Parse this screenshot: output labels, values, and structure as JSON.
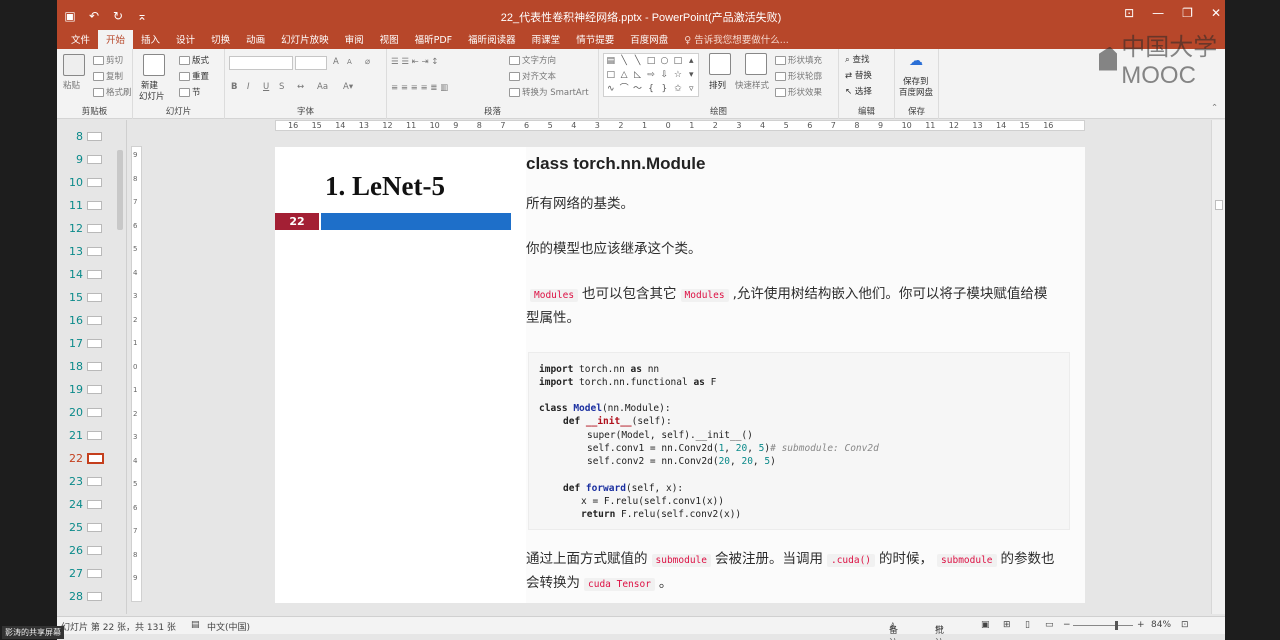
{
  "window": {
    "title": "22_代表性卷积神经网络.pptx - PowerPoint(产品激活失败)",
    "qat_icons": [
      "save-icon",
      "undo-icon",
      "redo-icon",
      "customize-icon"
    ],
    "controls": [
      "ribbon-display-icon",
      "minimize-icon",
      "restore-icon",
      "close-icon"
    ]
  },
  "tabs": [
    "文件",
    "开始",
    "插入",
    "设计",
    "切换",
    "动画",
    "幻灯片放映",
    "审阅",
    "视图",
    "福昕PDF",
    "福昕阅读器",
    "雨课堂",
    "情节提要",
    "百度网盘"
  ],
  "active_tab": "开始",
  "tell_me": "告诉我您想要做什么...",
  "ribbon": {
    "clipboard": {
      "label": "剪贴板",
      "paste": "粘贴",
      "cut": "剪切",
      "copy": "复制",
      "format_painter": "格式刷"
    },
    "slides": {
      "label": "幻灯片",
      "new_slide_1": "新建",
      "new_slide_2": "幻灯片",
      "layout": "版式",
      "reset": "重置",
      "section": "节"
    },
    "font": {
      "label": "字体",
      "bold": "B",
      "italic": "I",
      "underline": "U",
      "strike": "S",
      "grow": "A",
      "shrink": "A"
    },
    "paragraph": {
      "label": "段落",
      "text_direction": "文字方向",
      "align_text": "对齐文本",
      "smartart": "转换为 SmartArt"
    },
    "drawing": {
      "label": "绘图",
      "arrange": "排列",
      "quick_styles": "快速样式",
      "shape_fill": "形状填充",
      "shape_outline": "形状轮廓",
      "shape_effects": "形状效果"
    },
    "editing": {
      "label": "编辑",
      "find": "查找",
      "replace": "替换",
      "select": "选择"
    },
    "save": {
      "label": "保存",
      "save_to_1": "保存到",
      "save_to_2": "百度网盘"
    }
  },
  "thumbnails": [
    {
      "n": "8"
    },
    {
      "n": "9"
    },
    {
      "n": "10"
    },
    {
      "n": "11"
    },
    {
      "n": "12"
    },
    {
      "n": "13"
    },
    {
      "n": "14"
    },
    {
      "n": "15"
    },
    {
      "n": "16"
    },
    {
      "n": "17"
    },
    {
      "n": "18"
    },
    {
      "n": "19"
    },
    {
      "n": "20"
    },
    {
      "n": "21"
    },
    {
      "n": "22",
      "active": true
    },
    {
      "n": "23"
    },
    {
      "n": "24"
    },
    {
      "n": "25"
    },
    {
      "n": "26"
    },
    {
      "n": "27"
    },
    {
      "n": "28"
    }
  ],
  "h_ruler": [
    "16",
    "15",
    "14",
    "13",
    "12",
    "11",
    "10",
    "9",
    "8",
    "7",
    "6",
    "5",
    "4",
    "3",
    "2",
    "1",
    "0",
    "1",
    "2",
    "3",
    "4",
    "5",
    "6",
    "7",
    "8",
    "9",
    "10",
    "11",
    "12",
    "13",
    "14",
    "15",
    "16"
  ],
  "v_ruler": [
    "9",
    "8",
    "7",
    "6",
    "5",
    "4",
    "3",
    "2",
    "1",
    "0",
    "1",
    "2",
    "3",
    "4",
    "5",
    "6",
    "7",
    "8",
    "9"
  ],
  "slide": {
    "title": "1.   LeNet-5",
    "page_number": "22",
    "doc": {
      "heading": "class torch.nn.Module",
      "p1": "所有网络的基类。",
      "p2": "你的模型也应该继承这个类。",
      "p3_code1": "Modules",
      "p3_text1": "也可以包含其它",
      "p3_code2": "Modules",
      "p3_text2": ",允许使用树结构嵌入他们。你可以将子模块赋值给模",
      "p3_text3": "型属性。",
      "p4_text1": "通过上面方式赋值的",
      "p4_code1": "submodule",
      "p4_text2": "会被注册。当调用",
      "p4_code2": ".cuda()",
      "p4_text3": "的时候，",
      "p4_code3": "submodule",
      "p4_text4": "的参数也",
      "p4_text5": "会转换为",
      "p4_code4": "cuda Tensor",
      "p4_text6": "。"
    },
    "code": {
      "l1_kw": "import",
      "l1_rest": " torch.nn ",
      "l1_as": "as",
      "l1_name": " nn",
      "l2_kw": "import",
      "l2_rest": " torch.nn.functional ",
      "l2_as": "as",
      "l2_name": " F",
      "l3_kw": "class",
      "l3_name": " Model",
      "l3_rest": "(nn.Module):",
      "l4_kw": "def",
      "l4_name": " __init__",
      "l4_rest": "(self):",
      "l5": "super(Model, self).__init__()",
      "l6_a": "self.conv1 = nn.Conv2d(",
      "l6_n1": "1",
      "l6_c1": ", ",
      "l6_n2": "20",
      "l6_c2": ", ",
      "l6_n3": "5",
      "l6_b": ")",
      "l6_cm": "# submodule: Conv2d",
      "l7_a": "self.conv2 = nn.Conv2d(",
      "l7_n1": "20",
      "l7_c1": ", ",
      "l7_n2": "20",
      "l7_c2": ", ",
      "l7_n3": "5",
      "l7_b": ")",
      "l8_kw": "def",
      "l8_name": " forward",
      "l8_rest": "(self, x):",
      "l9": "x = F.relu(self.conv1(x))",
      "l10_kw": "return",
      "l10_rest": " F.relu(self.conv2(x))"
    }
  },
  "status": {
    "slide_info": "幻灯片 第 22 张，共 131 张",
    "language": "中文(中国)",
    "notes": "备注",
    "comments": "批注",
    "zoom": "84%",
    "zoom_value": 0.84
  },
  "watermark": "中国大学MOOC",
  "share_tag": "影涛的共享屏幕"
}
